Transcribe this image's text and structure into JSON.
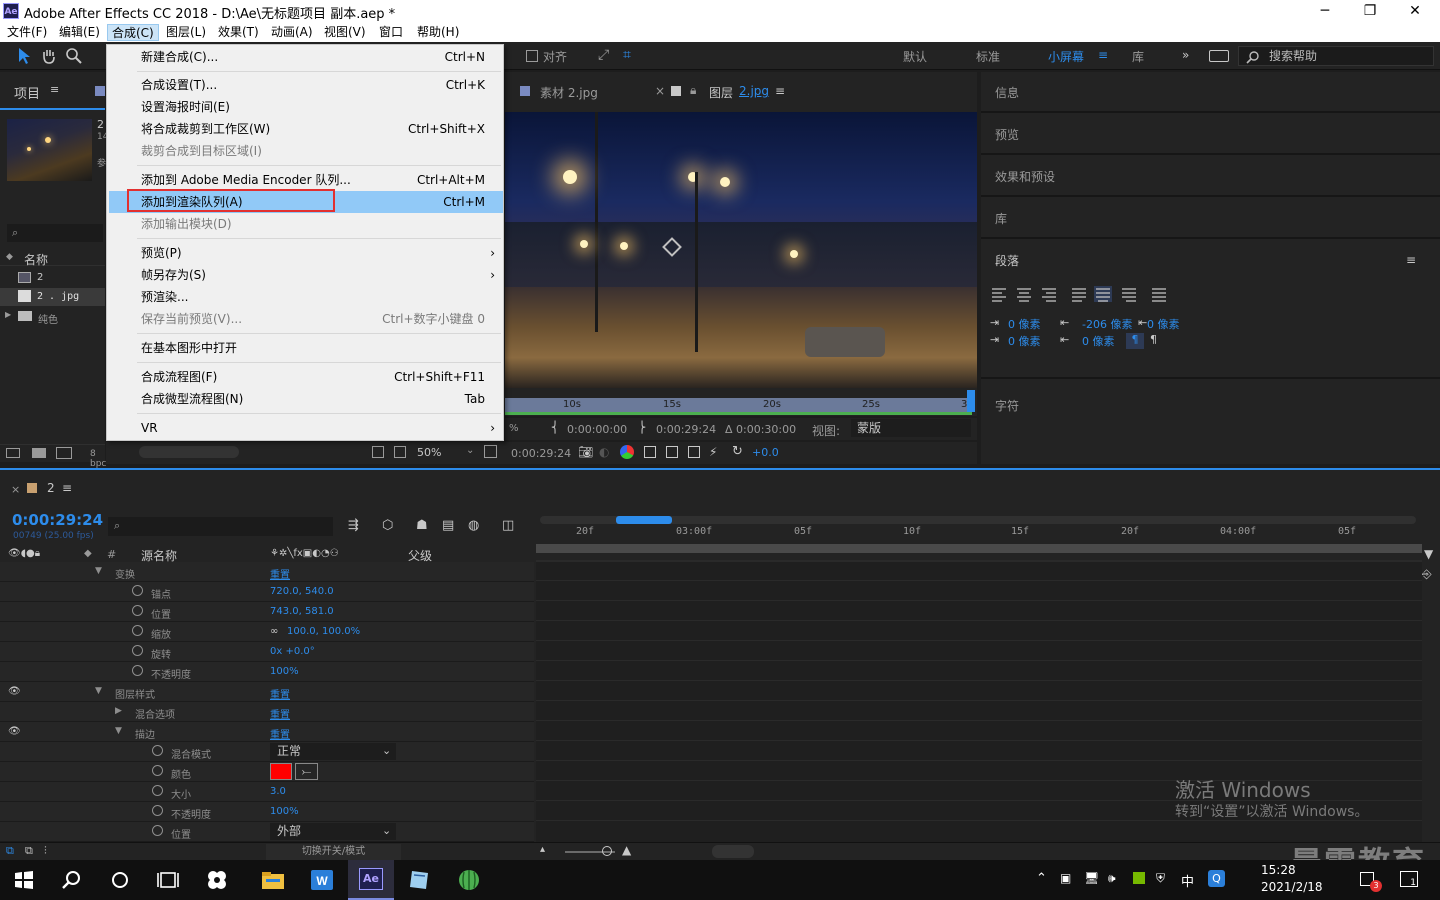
{
  "window": {
    "title": "Adobe After Effects CC 2018 - D:\\Ae\\无标题项目 副本.aep *",
    "logo": "Ae",
    "minimize": "─",
    "maximize": "❐",
    "close": "✕"
  },
  "menubar": {
    "items": [
      "文件(F)",
      "编辑(E)",
      "合成(C)",
      "图层(L)",
      "效果(T)",
      "动画(A)",
      "视图(V)",
      "窗口",
      "帮助(H)"
    ],
    "active_index": 2
  },
  "toolbar": {
    "snap": "对齐",
    "workspaces": [
      "默认",
      "标准",
      "小屏幕",
      "库"
    ],
    "active_workspace": "小屏幕",
    "more": "»",
    "search_placeholder": "搜索帮助"
  },
  "project": {
    "title": "项目",
    "col_name": "名称",
    "items": [
      {
        "label": "2",
        "type": "comp"
      },
      {
        "label": "2 . jpg",
        "type": "image"
      },
      {
        "label": "纯色",
        "type": "folder"
      }
    ],
    "bpc": "8 bpc",
    "thumb_info1": "2",
    "thumb_info2": "14",
    "thumb_info3": "参"
  },
  "viewer_tabs": {
    "footage": "素材 2.jpg",
    "layer_prefix": "图层",
    "layer_name": "2.jpg"
  },
  "dropdown": {
    "items": [
      {
        "label": "新建合成(C)...",
        "shortcut": "Ctrl+N"
      },
      {
        "sep": true
      },
      {
        "label": "合成设置(T)...",
        "shortcut": "Ctrl+K"
      },
      {
        "label": "设置海报时间(E)",
        "shortcut": ""
      },
      {
        "label": "将合成裁剪到工作区(W)",
        "shortcut": "Ctrl+Shift+X"
      },
      {
        "label": "裁剪合成到目标区域(I)",
        "shortcut": "",
        "disabled": true
      },
      {
        "sep": true
      },
      {
        "label": "添加到 Adobe Media Encoder 队列...",
        "shortcut": "Ctrl+Alt+M"
      },
      {
        "label": "添加到渲染队列(A)",
        "shortcut": "Ctrl+M",
        "highlight": true
      },
      {
        "label": "添加输出模块(D)",
        "shortcut": "",
        "disabled": true
      },
      {
        "sep": true
      },
      {
        "label": "预览(P)",
        "shortcut": "",
        "submenu": true
      },
      {
        "label": "帧另存为(S)",
        "shortcut": "",
        "submenu": true
      },
      {
        "label": "预渲染...",
        "shortcut": ""
      },
      {
        "label": "保存当前预览(V)...",
        "shortcut": "Ctrl+数字小键盘 0",
        "disabled": true
      },
      {
        "sep": true
      },
      {
        "label": "在基本图形中打开",
        "shortcut": ""
      },
      {
        "sep": true
      },
      {
        "label": "合成流程图(F)",
        "shortcut": "Ctrl+Shift+F11"
      },
      {
        "label": "合成微型流程图(N)",
        "shortcut": "Tab"
      },
      {
        "sep": true
      },
      {
        "label": "VR",
        "shortcut": "",
        "submenu": true
      }
    ]
  },
  "viewer": {
    "ruler_ticks": [
      "10s",
      "15s",
      "20s",
      "25s",
      "3"
    ],
    "time_in": "0:00:00:00",
    "time_out": "0:00:29:24",
    "duration": "Δ 0:00:30:00",
    "view_label": "视图:",
    "view_value": "蒙版",
    "zoom": "50%",
    "current_time": "0:00:29:24",
    "exposure": "+0.0",
    "percent_sign": "%"
  },
  "right_panels": {
    "info": "信息",
    "preview": "预览",
    "effects": "效果和预设",
    "library": "库",
    "paragraph": "段落",
    "character": "字符",
    "indent_left": "0 像素",
    "indent_first": "-206 像素",
    "indent_right": "0 像素",
    "space_before": "0 像素",
    "space_after": "0 像素"
  },
  "timeline": {
    "comp_name": "2",
    "timecode": "0:00:29:24",
    "frame_info": "00749 (25.00 fps)",
    "col_num": "#",
    "col_source": "源名称",
    "col_parent": "父级",
    "ruler": [
      "20f",
      "03:00f",
      "05f",
      "10f",
      "15f",
      "20f",
      "04:00f",
      "05f"
    ],
    "toggle_label": "切换开关/模式",
    "rows": [
      {
        "label": "变换",
        "value": "重置",
        "indent": 1,
        "twirl": "▼"
      },
      {
        "label": "锚点",
        "value": "720.0, 540.0",
        "indent": 2,
        "stopwatch": true
      },
      {
        "label": "位置",
        "value": "743.0, 581.0",
        "indent": 2,
        "stopwatch": true
      },
      {
        "label": "缩放",
        "value": "100.0, 100.0%",
        "indent": 2,
        "stopwatch": true
      },
      {
        "label": "旋转",
        "value": "0x +0.0°",
        "indent": 2,
        "stopwatch": true
      },
      {
        "label": "不透明度",
        "value": "100%",
        "indent": 2,
        "stopwatch": true
      },
      {
        "label": "图层样式",
        "value": "重置",
        "indent": 1,
        "twirl": "▼",
        "eye": true
      },
      {
        "label": "混合选项",
        "value": "重置",
        "indent": 2,
        "twirl": "▶"
      },
      {
        "label": "描边",
        "value": "重置",
        "indent": 2,
        "twirl": "▼",
        "eye": true
      },
      {
        "label": "混合模式",
        "value": "正常",
        "indent": 3,
        "stopwatch": true,
        "dropdown": true
      },
      {
        "label": "颜色",
        "value": "",
        "indent": 3,
        "stopwatch": true,
        "color": "#ff0000"
      },
      {
        "label": "大小",
        "value": "3.0",
        "indent": 3,
        "stopwatch": true
      },
      {
        "label": "不透明度",
        "value": "100%",
        "indent": 3,
        "stopwatch": true
      },
      {
        "label": "位置",
        "value": "外部",
        "indent": 3,
        "stopwatch": true,
        "dropdown": true
      }
    ]
  },
  "watermark": {
    "line1": "激活 Windows",
    "line2": "转到“设置”以激活 Windows。",
    "brand": "晨需教育"
  },
  "taskbar": {
    "time": "15:28",
    "date": "2021/2/18",
    "ime": "中",
    "ae": "Ae",
    "notif_badge": "3",
    "notif_count": "1"
  },
  "colors": {
    "accent": "#2d8ceb",
    "highlight": "#91c9f7",
    "redbox": "#e23030"
  }
}
